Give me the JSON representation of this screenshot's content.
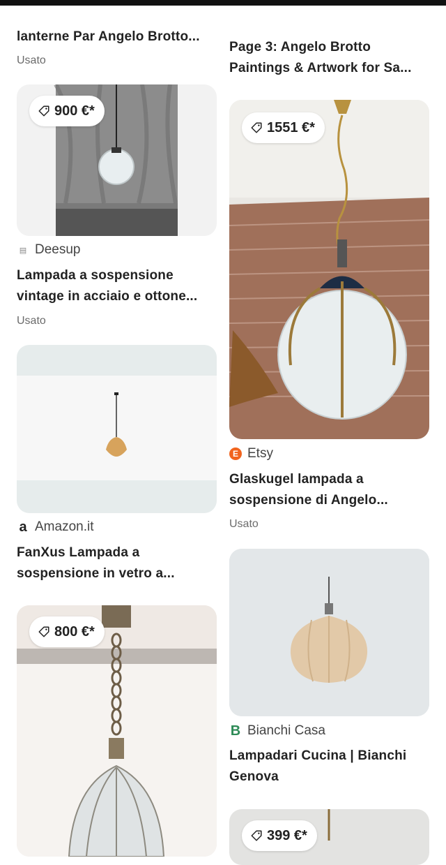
{
  "colors": {
    "etsy": "#f1641e",
    "bianchi": "#2e8b57",
    "amazon": "#222222"
  },
  "left": {
    "item0": {
      "title": "lanterne Par Angelo Brotto...",
      "condition": "Usato"
    },
    "item1": {
      "price": "900 €*",
      "source": "Deesup",
      "source_icon": "deesup-icon",
      "title_line1": "Lampada a sospensione",
      "title_line2": "vintage in acciaio e ottone...",
      "condition": "Usato"
    },
    "item2": {
      "source": "Amazon.it",
      "source_icon": "amazon-icon",
      "title_line1": "FanXus Lampada a",
      "title_line2": "sospensione in vetro a..."
    },
    "item3": {
      "price": "800 €*"
    }
  },
  "right": {
    "item0": {
      "title_line1": "Page 3: Angelo Brotto",
      "title_line2": "Paintings & Artwork for Sa..."
    },
    "item1": {
      "price": "1551 €*",
      "source": "Etsy",
      "source_icon": "etsy-icon",
      "source_icon_letter": "E",
      "title_line1": "Glaskugel lampada a",
      "title_line2": "sospensione di Angelo...",
      "condition": "Usato"
    },
    "item2": {
      "source": "Bianchi Casa",
      "source_icon": "bianchi-icon",
      "source_icon_letter": "B",
      "title_line1": "Lampadari Cucina | Bianchi",
      "title_line2": "Genova"
    },
    "item3": {
      "price": "399 €*"
    }
  }
}
